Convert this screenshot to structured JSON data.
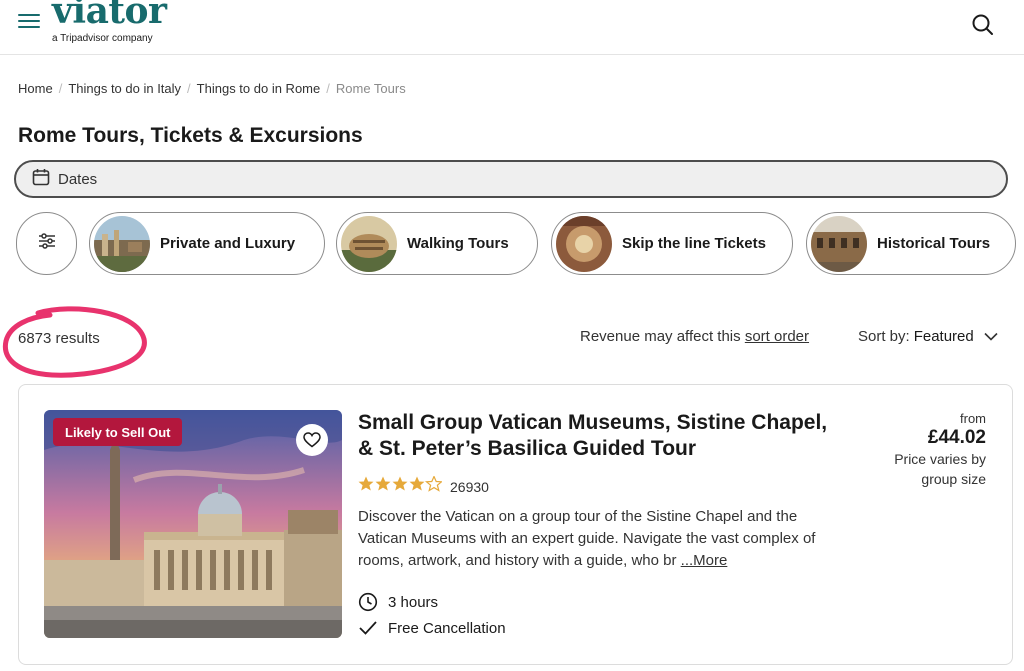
{
  "header": {
    "logo": "viator",
    "logo_sub": "a Tripadvisor company"
  },
  "breadcrumb": {
    "items": [
      "Home",
      "Things to do in Italy",
      "Things to do in Rome"
    ],
    "current": "Rome Tours"
  },
  "page_title": "Rome Tours, Tickets & Excursions",
  "dates": {
    "label": "Dates"
  },
  "chips": [
    {
      "label": "Private and Luxury"
    },
    {
      "label": "Walking Tours"
    },
    {
      "label": "Skip the line Tickets"
    },
    {
      "label": "Historical Tours"
    }
  ],
  "results": {
    "count": "6873 results",
    "revenue_prefix": "Revenue may affect this",
    "revenue_link": "sort order",
    "sort_label": "Sort by:",
    "sort_value": "Featured"
  },
  "card": {
    "badge": "Likely to Sell Out",
    "title": "Small Group Vatican Museums, Sistine Chapel, & St. Peter’s Basilica Guided Tour",
    "rating": 4.5,
    "rating_count": "26930",
    "description": "Discover the Vatican on a group tour of the Sistine Chapel and the Vatican Museums with an expert guide. Navigate the vast complex of rooms, artwork, and history with a guide, who br",
    "more": "...More",
    "duration": "3 hours",
    "cancellation": "Free Cancellation",
    "price_from": "from",
    "price": "£44.02",
    "price_note": "Price varies by group size"
  },
  "colors": {
    "brand": "#186b6d",
    "badge": "#b3173d",
    "star": "#e6a93a",
    "annotation": "#e8336d"
  }
}
